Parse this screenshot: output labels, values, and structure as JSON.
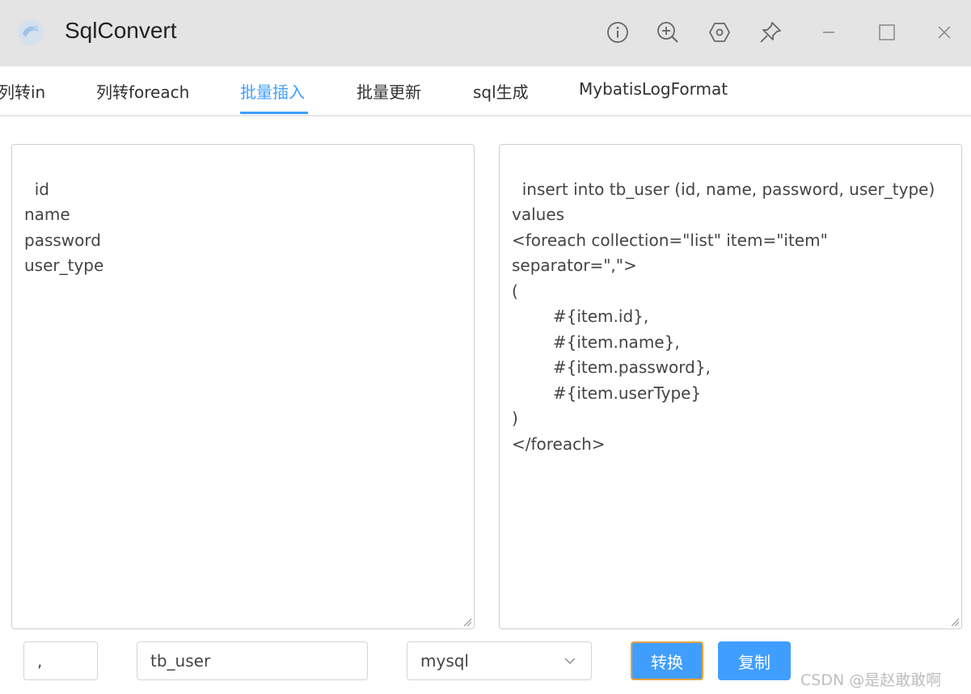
{
  "window": {
    "title": "SqlConvert",
    "buttons": [
      "info-icon",
      "zoom-in-icon",
      "settings-icon",
      "pin-icon",
      "minimize-icon",
      "maximize-icon",
      "close-icon"
    ]
  },
  "tabs": [
    {
      "label": "列转in"
    },
    {
      "label": "列转foreach"
    },
    {
      "label": "批量插入",
      "active": true
    },
    {
      "label": "批量更新"
    },
    {
      "label": "sql生成"
    },
    {
      "label": "MybatisLogFormat"
    }
  ],
  "left_text": "id\nname\npassword\nuser_type",
  "right_text": "insert into tb_user (id, name, password, user_type)\nvalues\n<foreach collection=\"list\" item=\"item\"\nseparator=\",\">\n(\n        #{item.id},\n        #{item.name},\n        #{item.password},\n        #{item.userType}\n)\n</foreach>",
  "controls": {
    "separator_value": ",",
    "table_value": "tb_user",
    "db_value": "mysql",
    "convert_label": "转换",
    "copy_label": "复制"
  },
  "colors": {
    "accent": "#409eff",
    "focus_border": "#e6a23c",
    "titlebar_bg": "#e4e4e4"
  },
  "watermark": "CSDN @是赵敢敢啊"
}
